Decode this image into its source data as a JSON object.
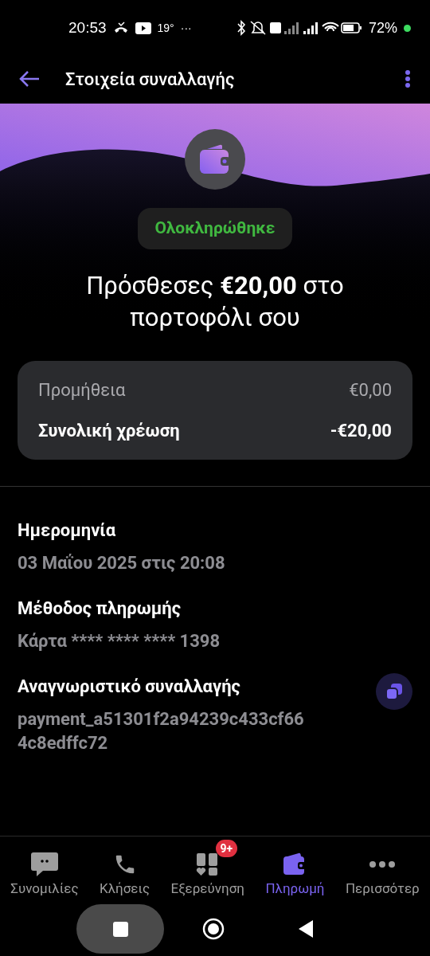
{
  "status_bar": {
    "time": "20:53",
    "temperature": "19°",
    "more": "···",
    "battery": "72%"
  },
  "header": {
    "title": "Στοιχεία συναλλαγής"
  },
  "status_badge": "Ολοκληρώθηκε",
  "headline": "Πρόσθεσες **€20,00** στο πορτοφόλι σου",
  "summary": [
    {
      "label": "Προμήθεια",
      "value": "€0,00",
      "emphasis": false
    },
    {
      "label": "Συνολική χρέωση",
      "value": "-€20,00",
      "emphasis": true
    }
  ],
  "details": [
    {
      "label": "Ημερομηνία",
      "value": "03 Μαΐου 2025 στις 20:08",
      "copyable": false
    },
    {
      "label": "Μέθοδος πληρωμής",
      "value": "Κάρτα **** **** **** 1398",
      "copyable": false
    },
    {
      "label": "Αναγνωριστικό συναλλαγής",
      "value": "payment_a51301f2a94239c433cf66 4c8edffc72",
      "copyable": true
    }
  ],
  "bottom_nav": [
    {
      "kind": "chat",
      "label": "Συνομιλίες",
      "selected": false
    },
    {
      "kind": "calls",
      "label": "Κλήσεις",
      "selected": false
    },
    {
      "kind": "explore",
      "label": "Εξερεύνηση",
      "selected": false,
      "badge": "9+"
    },
    {
      "kind": "wallet",
      "label": "Πληρωμή",
      "selected": true
    },
    {
      "kind": "more",
      "label": "Περισσότερ",
      "selected": false
    }
  ]
}
